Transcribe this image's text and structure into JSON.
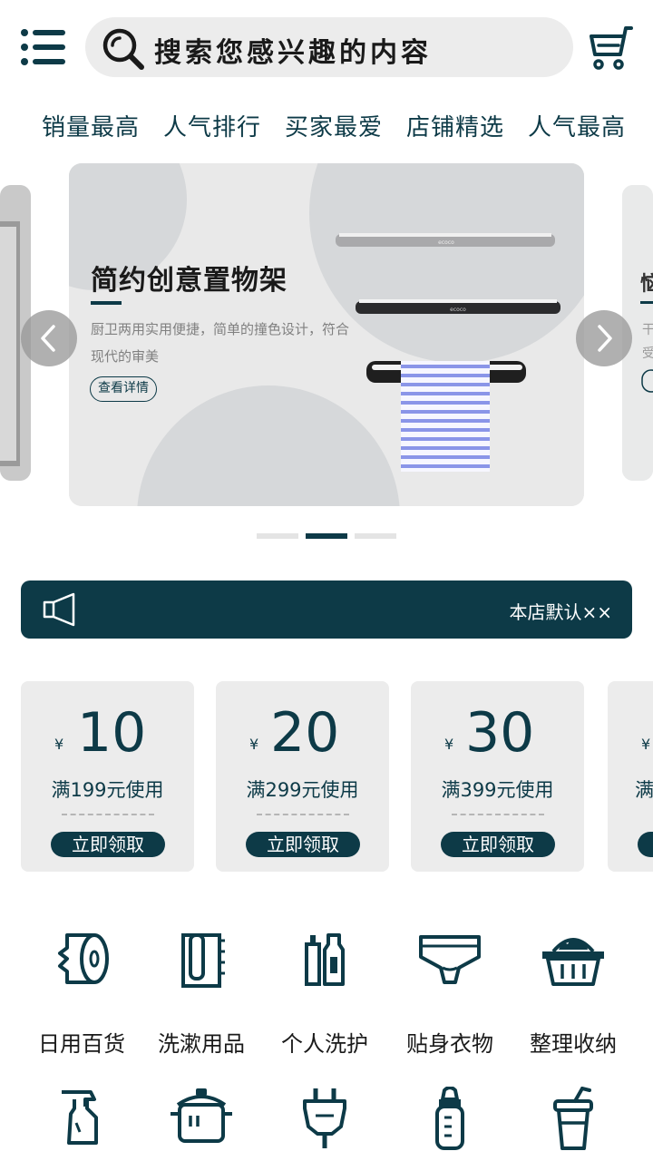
{
  "header": {
    "menu_icon": "menu-icon",
    "search_placeholder": "搜索您感兴趣的内容",
    "search_icon": "search-icon",
    "cart_icon": "cart-icon"
  },
  "tabs": [
    "销量最高",
    "人气排行",
    "买家最爱",
    "店铺精选",
    "人气最高"
  ],
  "banner": {
    "title": "简约创意置物架",
    "desc": "厨卫两用实用便捷，简单的撞色设计，符合现代的审美",
    "button": "查看详情",
    "product_brand": "ecoco"
  },
  "carousel": {
    "active_index": 1,
    "count": 3
  },
  "notice": {
    "text": "本店默认××"
  },
  "coupons": [
    {
      "currency": "¥",
      "amount": "10",
      "condition": "满199元使用",
      "button": "立即领取"
    },
    {
      "currency": "¥",
      "amount": "20",
      "condition": "满299元使用",
      "button": "立即领取"
    },
    {
      "currency": "¥",
      "amount": "30",
      "condition": "满399元使用",
      "button": "立即领取"
    },
    {
      "currency": "¥",
      "amount": "",
      "condition": "满",
      "button": ""
    }
  ],
  "categories": [
    {
      "label": "日用百货",
      "icon": "toilet-paper-icon"
    },
    {
      "label": "洗漱用品",
      "icon": "towel-icon"
    },
    {
      "label": "个人洗护",
      "icon": "toiletries-icon"
    },
    {
      "label": "贴身衣物",
      "icon": "underwear-icon"
    },
    {
      "label": "整理收纳",
      "icon": "basket-icon"
    }
  ],
  "categories_row2": [
    {
      "icon": "spray-bottle-icon"
    },
    {
      "icon": "cooking-pot-icon"
    },
    {
      "icon": "plug-icon"
    },
    {
      "icon": "baby-bottle-icon"
    },
    {
      "icon": "drink-cup-icon"
    }
  ],
  "colors": {
    "primary": "#0d3a47",
    "card_bg": "#ececec"
  }
}
